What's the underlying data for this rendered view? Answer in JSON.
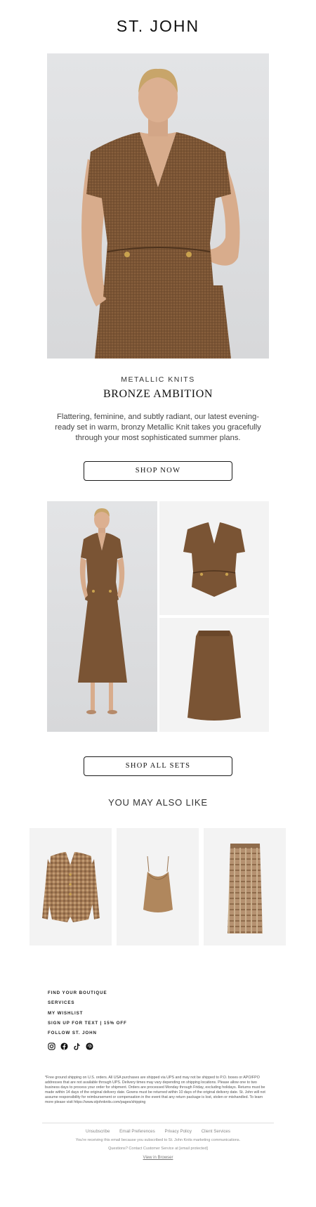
{
  "header": {
    "brand": "ST. JOHN"
  },
  "hero": {
    "image_icon": "model-in-bronze-metallic-knit-wrap-top-photo",
    "eyebrow": "METALLIC KNITS",
    "headline": "BRONZE AMBITION",
    "body": "Flattering, feminine, and subtly radiant, our latest evening-ready set in warm, bronzy Metallic Knit takes you gracefully through your most sophisticated summer plans.",
    "cta": "SHOP NOW"
  },
  "sets": {
    "images": [
      "model-full-length-set-photo",
      "wrap-top-product-photo",
      "midi-skirt-product-photo"
    ],
    "cta": "SHOP ALL SETS"
  },
  "recommendations": {
    "title": "YOU MAY ALSO LIKE",
    "items": [
      "tweed-peplum-jacket-photo",
      "bronze-cowl-camisole-photo",
      "plaid-pencil-skirt-photo"
    ]
  },
  "footer": {
    "links": [
      "FIND YOUR BOUTIQUE",
      "SERVICES",
      "MY WISHLIST",
      "SIGN UP FOR TEXT  |  15% OFF",
      "FOLLOW ST. JOHN"
    ],
    "social_icons": [
      "instagram-icon",
      "facebook-icon",
      "tiktok-icon",
      "pinterest-icon"
    ],
    "legal": "*Free ground shipping on U.S. orders. All USA purchases are shipped via UPS and may not be shipped to P.O. boxes or APO/FPO addresses that are not available through UPS. Delivery times may vary depending on shipping locations. Please allow one to two business days to process your order for shipment. Orders are processed Monday through Friday, excluding holidays. Returns must be made within 14 days of the original delivery date. Gowns must be returned within 10 days of the original delivery date. St. John will not assume responsibility for reimbursement or compensation in the event that any return package is lost, stolen or mishandled. To learn more please visit https://www.stjohnknits.com/pages/shipping",
    "nav": [
      "Unsubscribe",
      "Email Preferences",
      "Privacy Policy",
      "Client Services"
    ],
    "note1": "You're receiving this email because you subscribed to St. John Knits marketing communications.",
    "note2": "Questions? Contact Customer Service at [email protected]",
    "view_in_browser": "View in Browser"
  },
  "colors": {
    "bronze": "#7a5434",
    "bronze_dark": "#5a3b22",
    "photo_bg": "#dcdddf",
    "product_bg": "#f3f3f3"
  }
}
